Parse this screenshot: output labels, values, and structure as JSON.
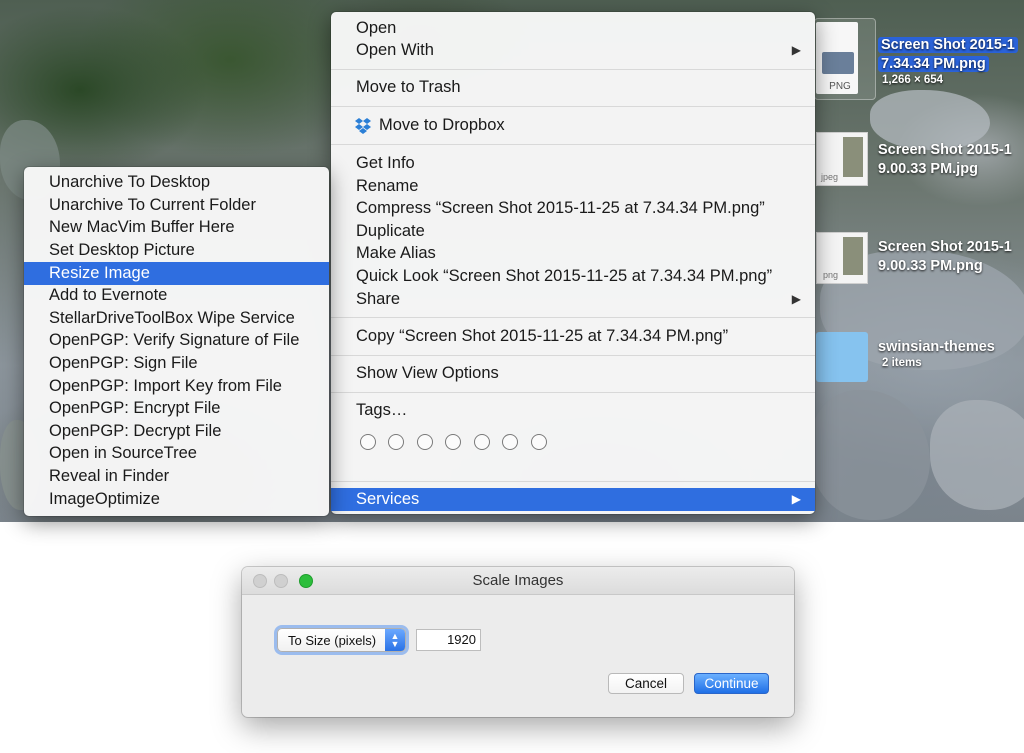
{
  "main_menu": {
    "items": [
      {
        "label": "Open"
      },
      {
        "label": "Open With",
        "submenu": true
      },
      {
        "label": "Move to Trash"
      },
      {
        "label": "Move to Dropbox",
        "icon": "dropbox-icon"
      },
      {
        "label": "Get Info"
      },
      {
        "label": "Rename"
      },
      {
        "label": "Compress “Screen Shot 2015-11-25 at 7.34.34 PM.png”"
      },
      {
        "label": "Duplicate"
      },
      {
        "label": "Make Alias"
      },
      {
        "label": "Quick Look “Screen Shot 2015-11-25 at 7.34.34 PM.png”"
      },
      {
        "label": "Share",
        "submenu": true
      },
      {
        "label": "Copy “Screen Shot 2015-11-25 at 7.34.34 PM.png”"
      },
      {
        "label": "Show View Options"
      },
      {
        "label": "Tags…"
      },
      {
        "label": "Services",
        "submenu": true,
        "highlighted": true
      }
    ],
    "tag_color_count": 7
  },
  "services_menu": {
    "items": [
      {
        "label": "Unarchive To Desktop"
      },
      {
        "label": "Unarchive To Current Folder"
      },
      {
        "label": "New MacVim Buffer Here"
      },
      {
        "label": "Set Desktop Picture"
      },
      {
        "label": "Resize Image",
        "highlighted": true
      },
      {
        "label": "Add to Evernote"
      },
      {
        "label": "StellarDriveToolBox Wipe Service"
      },
      {
        "label": "OpenPGP: Verify Signature of File"
      },
      {
        "label": "OpenPGP: Sign File"
      },
      {
        "label": "OpenPGP: Import Key from File"
      },
      {
        "label": "OpenPGP: Encrypt File"
      },
      {
        "label": "OpenPGP: Decrypt File"
      },
      {
        "label": "Open in SourceTree"
      },
      {
        "label": "Reveal in Finder"
      },
      {
        "label": "ImageOptimize"
      }
    ]
  },
  "desktop_icons": [
    {
      "name_line1": "Screen Shot 2015-1",
      "name_line2": "7.34.34 PM.png",
      "sub": "1,266 × 654",
      "badge": "PNG",
      "selected": true
    },
    {
      "name_line1": "Screen Shot 2015-1",
      "name_line2": "9.00.33 PM.jpg",
      "badge": "jpeg"
    },
    {
      "name_line1": "Screen Shot 2015-1",
      "name_line2": "9.00.33 PM.png",
      "badge": "png"
    },
    {
      "name_line1": "swinsian-themes",
      "sub": "2 items"
    }
  ],
  "dialog": {
    "title": "Scale Images",
    "mode_select": "To Size (pixels)",
    "size_value": "1920",
    "cancel_label": "Cancel",
    "continue_label": "Continue"
  },
  "colors": {
    "highlight": "#2f6ee0",
    "accent_button": "#1f6fe6",
    "traffic_close": "#d0d0d0",
    "traffic_min": "#d0d0d0",
    "traffic_zoom": "#2dbe3c"
  }
}
